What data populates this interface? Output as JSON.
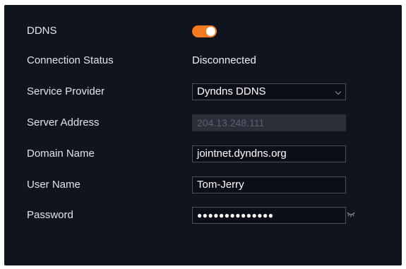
{
  "form": {
    "ddns": {
      "label": "DDNS",
      "enabled": true,
      "toggle_color": "#f47b21"
    },
    "connection_status": {
      "label": "Connection Status",
      "value": "Disconnected"
    },
    "service_provider": {
      "label": "Service Provider",
      "value": "Dyndns DDNS",
      "icon": "chevron-down-icon"
    },
    "server_address": {
      "label": "Server Address",
      "value": "204.13.248.111",
      "disabled": true
    },
    "domain_name": {
      "label": "Domain Name",
      "value": "jointnet.dyndns.org"
    },
    "user_name": {
      "label": "User Name",
      "value": "Tom-Jerry"
    },
    "password": {
      "label": "Password",
      "masked_value": "●●●●●●●●●●●●●●",
      "icon": "eye-closed-icon"
    }
  },
  "colors": {
    "panel_background": "#10141e",
    "accent": "#f47b21",
    "text": "#e2e4e8",
    "field_border": "#4a4f5c",
    "disabled_field": "#2a2f3a"
  }
}
